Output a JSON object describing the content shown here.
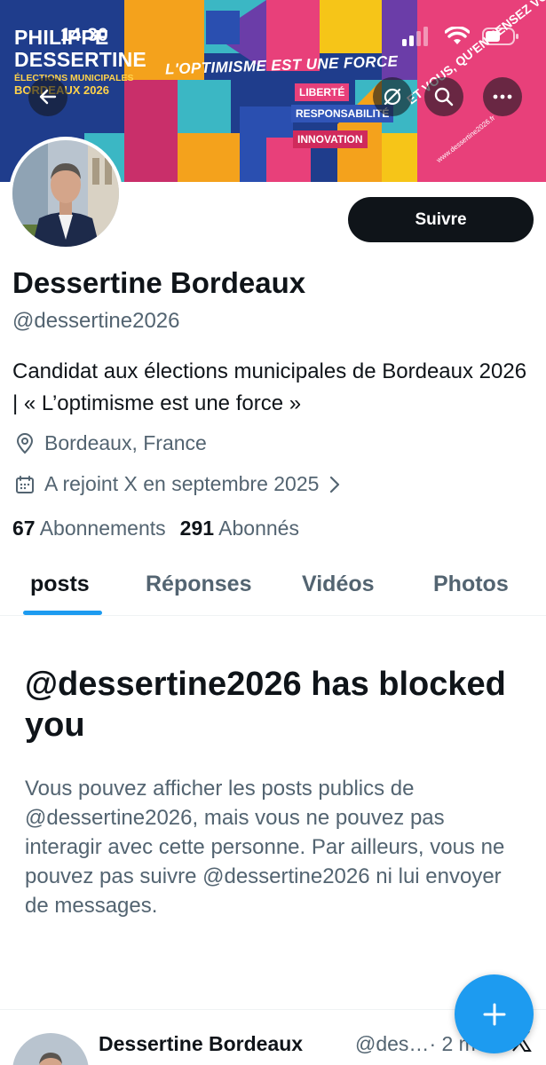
{
  "status_bar": {
    "time": "14:30"
  },
  "banner": {
    "name_line1": "PHILIPPE",
    "name_line2": "DESSERTINE",
    "subtitle": "ÉLECTIONS MUNICIPALES",
    "city_year": "BORDEAUX 2026",
    "slogan": "L'OPTIMISME EST UNE FORCE",
    "tags": [
      "LIBERTÉ",
      "RESPONSABILITÉ",
      "INNOVATION"
    ],
    "question": "ET VOUS, QU'EN PENSEZ VOUS ?",
    "url": "www.dessertine2026.fr"
  },
  "profile": {
    "display_name": "Dessertine Bordeaux",
    "handle": "@dessertine2026",
    "bio": "Candidat aux élections municipales de Bordeaux 2026 | « L’optimisme est une force »",
    "location": "Bordeaux, France",
    "joined": "A rejoint X en septembre 2025",
    "following_count": "67",
    "following_label": "Abonnements",
    "followers_count": "291",
    "followers_label": "Abonnés",
    "follow_button": "Suivre"
  },
  "tabs": [
    {
      "label": "posts",
      "active": true
    },
    {
      "label": "Réponses",
      "active": false
    },
    {
      "label": "Vidéos",
      "active": false
    },
    {
      "label": "Photos",
      "active": false
    }
  ],
  "blocked": {
    "title": "@dessertine2026 has blocked you",
    "message": "Vous pouvez afficher les posts publics de @dessertine2026, mais vous ne pouvez pas interagir avec cette personne. Par ailleurs, vous ne pouvez pas suivre @dessertine2026 ni lui envoyer de messages."
  },
  "post_preview": {
    "name": "Dessertine Bordeaux",
    "handle": "@des…",
    "time": "· 2 m"
  },
  "icons": {
    "back": "back-arrow-icon",
    "translate": "translate-icon",
    "search": "search-icon",
    "more": "more-icon",
    "location": "location-pin-icon",
    "calendar": "calendar-icon",
    "compose": "compose-plus-icon",
    "logo": "x-logo-icon"
  },
  "colors": {
    "accent": "#1d9bf0",
    "text_primary": "#0f1419",
    "text_secondary": "#536471",
    "button_dark": "#0f1419"
  }
}
